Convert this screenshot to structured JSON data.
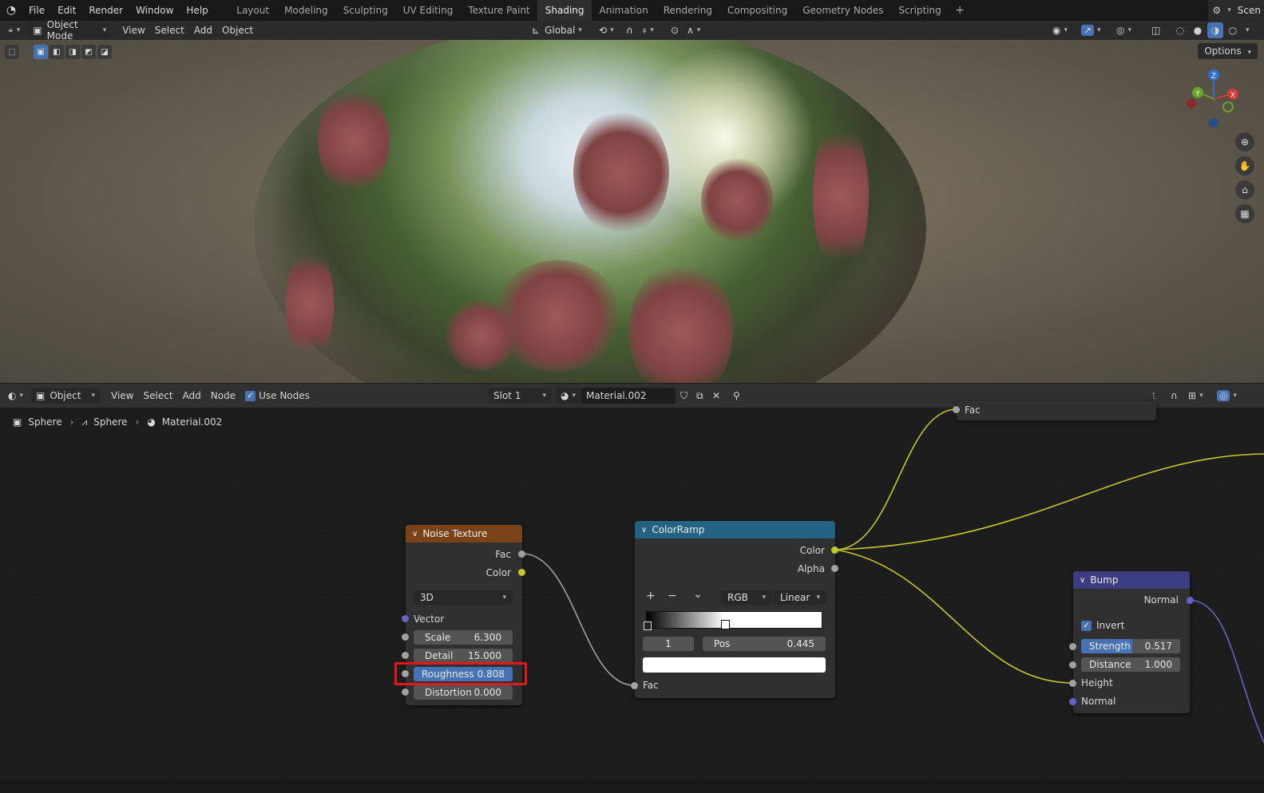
{
  "topbar": {
    "menus": [
      "File",
      "Edit",
      "Render",
      "Window",
      "Help"
    ],
    "workspaces": [
      "Layout",
      "Modeling",
      "Sculpting",
      "UV Editing",
      "Texture Paint",
      "Shading",
      "Animation",
      "Rendering",
      "Compositing",
      "Geometry Nodes",
      "Scripting"
    ],
    "active_workspace": "Shading",
    "add_tab": "+",
    "scene_label": "Scen"
  },
  "viewport_header": {
    "mode": "Object Mode",
    "menus": [
      "View",
      "Select",
      "Add",
      "Object"
    ],
    "orientation": "Global",
    "options": "Options"
  },
  "gizmo": {
    "x": "X",
    "y": "Y",
    "z": "Z"
  },
  "node_editor_header": {
    "editor_type": "Object",
    "menus": [
      "View",
      "Select",
      "Add",
      "Node"
    ],
    "use_nodes_label": "Use Nodes",
    "use_nodes_checked": true,
    "slot": "Slot 1",
    "material": "Material.002"
  },
  "breadcrumb": {
    "object": "Sphere",
    "mesh": "Sphere",
    "material": "Material.002"
  },
  "nodes": {
    "fac_stub": {
      "label": "Fac"
    },
    "noise": {
      "title": "Noise Texture",
      "out_fac": "Fac",
      "out_color": "Color",
      "dimensions": "3D",
      "vector": "Vector",
      "scale_label": "Scale",
      "scale_value": "6.300",
      "detail_label": "Detail",
      "detail_value": "15.000",
      "roughness_label": "Roughness",
      "roughness_value": "0.808",
      "distortion_label": "Distortion",
      "distortion_value": "0.000"
    },
    "colorramp": {
      "title": "ColorRamp",
      "out_color": "Color",
      "out_alpha": "Alpha",
      "add": "+",
      "remove": "−",
      "more": "⌄",
      "color_mode": "RGB",
      "interpolation": "Linear",
      "index": "1",
      "pos_label": "Pos",
      "pos_value": "0.445",
      "in_fac": "Fac"
    },
    "bump": {
      "title": "Bump",
      "out_normal": "Normal",
      "invert_label": "Invert",
      "invert_checked": true,
      "strength_label": "Strength",
      "strength_value": "0.517",
      "distance_label": "Distance",
      "distance_value": "1.000",
      "in_height": "Height",
      "in_normal": "Normal"
    }
  },
  "colors": {
    "noise_header": "#7a4219",
    "colorramp_header": "#246283",
    "bump_header": "#3c3c83",
    "highlight_box": "#e01818",
    "socket_gray": "#a1a1a1",
    "socket_yellow": "#c7c729",
    "socket_purple": "#6363c7",
    "active_field": "#4772b3"
  }
}
